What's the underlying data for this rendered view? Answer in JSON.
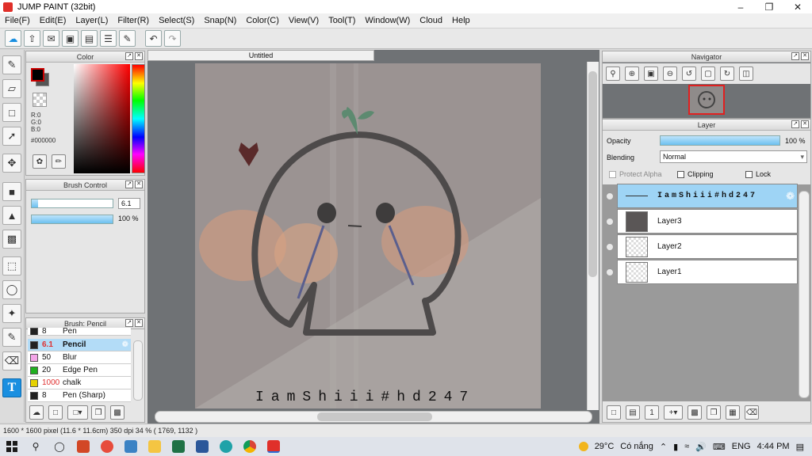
{
  "window": {
    "title": "JUMP PAINT (32bit)"
  },
  "menu": [
    "File(F)",
    "Edit(E)",
    "Layer(L)",
    "Filter(R)",
    "Select(S)",
    "Snap(N)",
    "Color(C)",
    "View(V)",
    "Tool(T)",
    "Window(W)",
    "Cloud",
    "Help"
  ],
  "color_panel": {
    "title": "Color",
    "r": "R:0",
    "g": "G:0",
    "b": "B:0",
    "hex": "#000000",
    "fg_color": "#000000"
  },
  "brush_control": {
    "title": "Brush Control",
    "size": "6.1",
    "opacity": "100 %",
    "size_level": 0.08,
    "opacity_level": 1.0
  },
  "brush_list": {
    "title": "Brush: Pencil",
    "items": [
      {
        "size": "8",
        "name": "Pen",
        "color": "#222222"
      },
      {
        "size": "6.1",
        "name": "Pencil",
        "color": "#222222",
        "selected": true
      },
      {
        "size": "50",
        "name": "Blur",
        "color": "#f4a6e8"
      },
      {
        "size": "20",
        "name": "Edge Pen",
        "color": "#20b020"
      },
      {
        "size": "1000",
        "name": "chalk",
        "color": "#e6d200"
      },
      {
        "size": "8",
        "name": "Pen (Sharp)",
        "color": "#222222"
      }
    ]
  },
  "document": {
    "tab": "Untitled",
    "watermark": "IamShiii#hd247"
  },
  "navigator": {
    "title": "Navigator"
  },
  "layer_panel": {
    "title": "Layer",
    "opacity_label": "Opacity",
    "opacity_value": "100 %",
    "blending_label": "Blending",
    "blending_value": "Normal",
    "protect_alpha": "Protect Alpha",
    "clipping": "Clipping",
    "lock": "Lock",
    "layers": [
      {
        "name": "IamShiii#hd247",
        "selected": true
      },
      {
        "name": "Layer3"
      },
      {
        "name": "Layer2"
      },
      {
        "name": "Layer1"
      }
    ]
  },
  "status": {
    "text": "1600 * 1600 pixel  (11.6 * 11.6cm)  350 dpi  34 %  ( 1769, 1132 )"
  },
  "taskbar": {
    "temperature": "29°C",
    "weather": "Có nắng",
    "lang": "ENG",
    "time": "4:44 PM"
  }
}
